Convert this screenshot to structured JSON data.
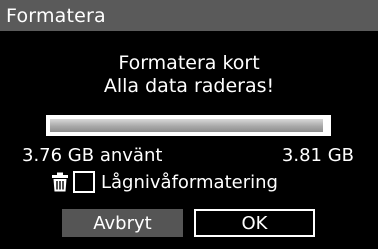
{
  "header": {
    "title": "Formatera"
  },
  "dialog": {
    "heading_line1": "Formatera kort",
    "heading_line2": "Alla data raderas!"
  },
  "storage": {
    "used_label": "3.76 GB använt",
    "total_label": "3.81 GB",
    "used_fraction": 0.987
  },
  "options": {
    "low_level_format_label": "Lågnivåformatering",
    "low_level_format_checked": false,
    "icon": "trash-icon"
  },
  "buttons": {
    "cancel_label": "Avbryt",
    "ok_label": "OK"
  },
  "colors": {
    "background": "#000000",
    "title_bar": "#5a5a5a",
    "cancel_button": "#555555",
    "text": "#ffffff"
  }
}
